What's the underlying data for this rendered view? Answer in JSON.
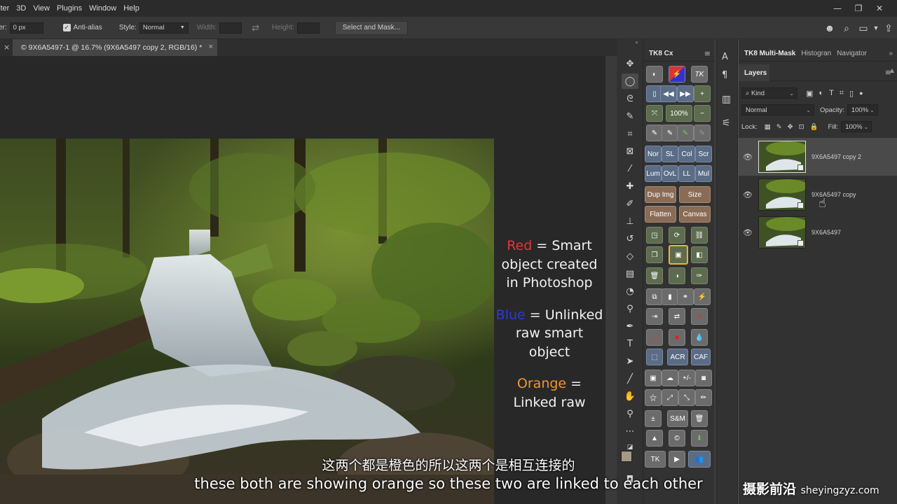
{
  "menu": [
    "lter",
    "3D",
    "View",
    "Plugins",
    "Window",
    "Help"
  ],
  "options": {
    "feather_label": "er:",
    "feather_value": "0 px",
    "antialias": "Anti-alias",
    "style_label": "Style:",
    "style_value": "Normal",
    "width_label": "Width:",
    "height_label": "Height:",
    "select_mask": "Select and Mask..."
  },
  "document": {
    "tab_title": "© 9X6A5497-1 @ 16.7% (9X6A5497 copy 2, RGB/16) *"
  },
  "annotation": {
    "red_word": "Red",
    "red_text": "= Smart object created in Photoshop",
    "blue_word": "Blue",
    "blue_text": "= Unlinked raw smart object",
    "orange_word": "Orange",
    "orange_text": "= Linked raw"
  },
  "subtitles": {
    "cn": "这两个都是橙色的所以这两个是相互连接的",
    "en": "these both are showing orange so these two are linked to each other"
  },
  "tk8": {
    "title": "TK8 Cx",
    "zoom": "100%",
    "blend_buttons": [
      "Nor",
      "SL",
      "Col",
      "Scr",
      "Lum",
      "OvL",
      "LL",
      "Mul"
    ],
    "dup_img": "Dup Img",
    "size": "Size",
    "flatten": "Flatten",
    "canvas": "Canvas",
    "acr": "ACR",
    "caf": "CAF",
    "sam": "S&M",
    "pm": "+/-",
    "tk": "TK"
  },
  "panels": {
    "tabs": [
      "TK8 Multi-Mask",
      "Histogran",
      "Navigator"
    ],
    "layers_tab": "Layers",
    "kind": "Kind",
    "blend_mode": "Normal",
    "opacity_label": "Opacity:",
    "opacity_value": "100%",
    "lock_label": "Lock:",
    "fill_label": "Fill:",
    "fill_value": "100%",
    "layers": [
      {
        "name": "9X6A5497 copy 2"
      },
      {
        "name": "9X6A5497 copy"
      },
      {
        "name": "9X6A5497"
      }
    ]
  },
  "watermark": {
    "cn": "摄影前沿",
    "url": "sheyingzyz.com"
  },
  "colors": {
    "red": "#e2363b",
    "blue": "#2a3bd6",
    "orange": "#f0962e",
    "highlight": "#f0b32e"
  }
}
